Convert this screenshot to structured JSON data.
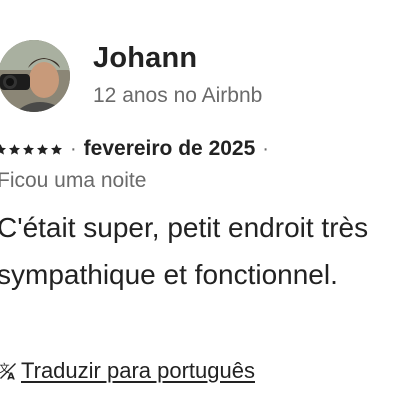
{
  "reviewer": {
    "name": "Johann",
    "tenure": "12 anos no Airbnb"
  },
  "review": {
    "rating": 5,
    "date": "fevereiro de 2025",
    "stay": "Ficou uma noite",
    "text": "C'était super, petit endroit très sympathique et fonctionnel.",
    "separator": "·"
  },
  "translate": {
    "label": "Traduzir para português",
    "icon": "translate-icon"
  },
  "colors": {
    "primary_text": "#222222",
    "secondary_text": "#6a6a6a"
  }
}
